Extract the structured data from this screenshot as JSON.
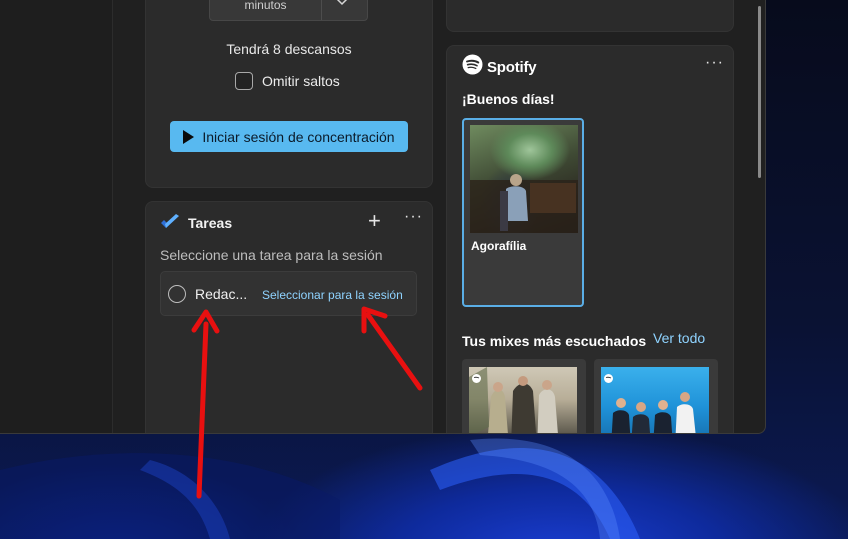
{
  "focus": {
    "minutes_label": "minutos",
    "breaks_text": "Tendrá 8 descansos",
    "skip_label": "Omitir saltos",
    "start_button_label": "Iniciar sesión de concentración"
  },
  "tasks": {
    "title": "Tareas",
    "subtitle": "Seleccione una tarea para la sesión",
    "items": [
      {
        "title": "Redac...",
        "action_label": "Seleccionar para la sesión"
      }
    ]
  },
  "spotify": {
    "brand": "Spotify",
    "greeting": "¡Buenos días!",
    "album": {
      "name": "Agorafília"
    },
    "mixes_title": "Tus mixes más escuchados",
    "see_all_label": "Ver todo"
  },
  "icons": {
    "chevron": "chevron-down-icon",
    "play": "play-icon",
    "todo": "microsoft-todo-icon",
    "plus": "plus-icon",
    "more": "more-options-icon",
    "spotify": "spotify-logo-icon"
  },
  "colors": {
    "accent_button": "#58b9f0",
    "link": "#8fd3ff",
    "annotation_arrow": "#e81010",
    "selected_border": "#5aaee6"
  }
}
